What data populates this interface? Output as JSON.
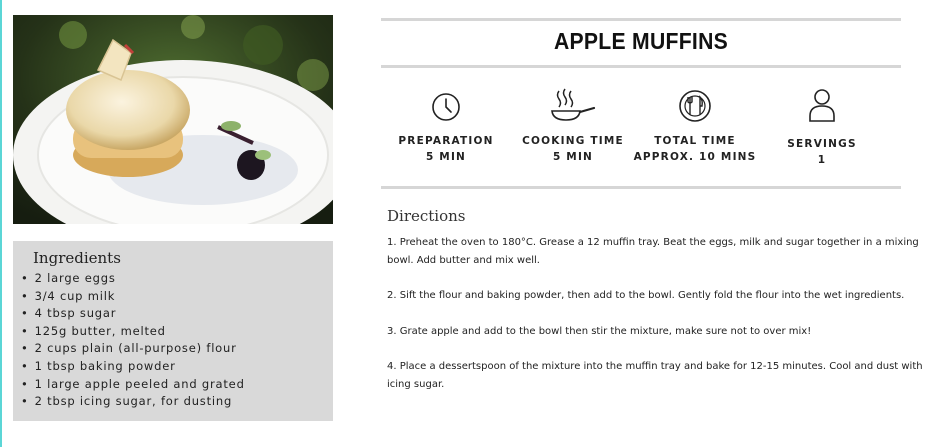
{
  "photo": {
    "alt": "Apple muffin with icing sugar on a white plate"
  },
  "ingredients": {
    "title": "Ingredients",
    "items": [
      "2 large eggs",
      "3/4 cup milk",
      "4 tbsp sugar",
      "125g butter, melted",
      "2 cups plain (all-purpose) flour",
      "1 tbsp baking powder",
      "1 large apple peeled and grated",
      "2 tbsp icing sugar, for dusting"
    ]
  },
  "recipe": {
    "title": "APPLE MUFFINS",
    "stats": [
      {
        "icon": "clock-icon",
        "line1": "PREPARATION",
        "line2": "5 MIN"
      },
      {
        "icon": "frying-pan-icon",
        "line1": "COOKING TIME",
        "line2": "5 MIN"
      },
      {
        "icon": "plate-cutlery-icon",
        "line1": "TOTAL TIME",
        "line2": "APPROX. 10 MINS"
      },
      {
        "icon": "person-icon",
        "line1": "SERVINGS",
        "line2": "1"
      }
    ]
  },
  "directions": {
    "title": "Directions",
    "steps": [
      "1. Preheat the oven to 180°C. Grease a 12 muffin tray. Beat the eggs, milk and sugar together in a mixing bowl. Add butter and mix well.",
      "2. Sift the flour and baking powder, then add to the bowl. Gently fold the flour into the wet ingredients.",
      "3. Grate apple and add to the bowl then stir the mixture, make sure not to over mix!",
      "4. Place a dessertspoon of the mixture into the muffin tray and bake for 12-15 minutes. Cool and dust with icing sugar."
    ]
  },
  "colors": {
    "panel": "#d9d9d9",
    "rule": "#d6d6d6",
    "accent": "#5bd6d6"
  }
}
